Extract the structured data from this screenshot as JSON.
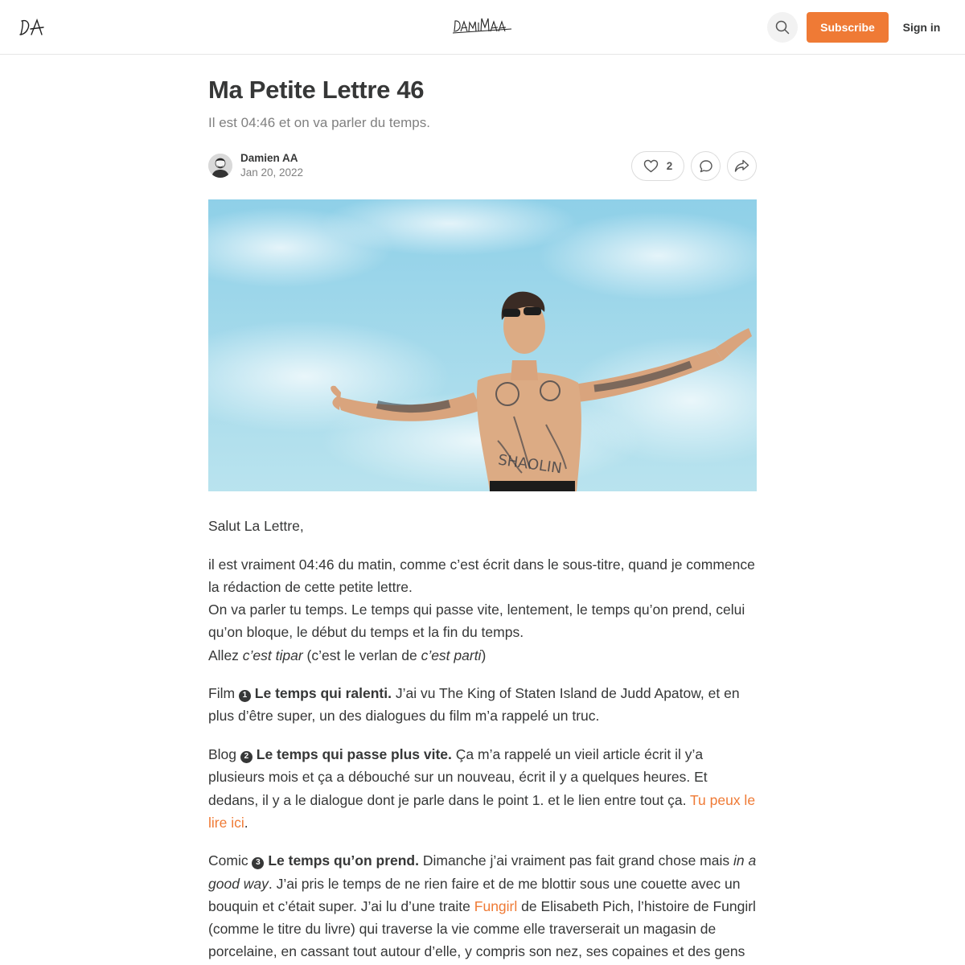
{
  "header": {
    "logo_left": "DA",
    "logo_center": "DAMIMAA",
    "subscribe_label": "Subscribe",
    "signin_label": "Sign in"
  },
  "post": {
    "title": "Ma Petite Lettre 46",
    "subtitle": "Il est 04:46 et on va parler du temps.",
    "author": "Damien AA",
    "date": "Jan 20, 2022",
    "like_count": "2"
  },
  "body": {
    "greeting": "Salut La Lettre,",
    "intro_1": "il est vraiment 04:46 du matin, comme c’est écrit dans le sous-titre, quand je commence la rédaction de cette petite lettre.",
    "intro_2": "On va parler tu temps. Le temps qui passe vite, lentement, le temps qu’on prend, celui qu’on bloque, le début du temps et la fin du temps.",
    "intro_3_a": "Allez ",
    "intro_3_em1": "c’est tipar",
    "intro_3_b": " (c’est le verlan de ",
    "intro_3_em2": "c’est parti",
    "intro_3_c": ")",
    "film_prefix": "Film ",
    "film_num": "1",
    "film_title": "Le temps qui ralenti.",
    "film_text": " J’ai vu The King of Staten Island de Judd Apatow, et en plus d’être super, un des dialogues du film m’a rappelé un truc.",
    "blog_prefix": "Blog ",
    "blog_num": "2",
    "blog_title": "Le temps qui passe plus vite.",
    "blog_text": " Ça m’a rappelé un vieil article écrit il y’a plusieurs mois et ça a débouché sur un nouveau, écrit il y a quelques heures. Et dedans, il y a le dialogue dont je parle dans le point 1. et le lien entre tout ça. ",
    "blog_link": "Tu peux le lire ici",
    "blog_end": ".",
    "comic_prefix": "Comic ",
    "comic_num": "3",
    "comic_title": "Le temps qu’on prend.",
    "comic_text_1": " Dimanche j’ai vraiment pas fait grand chose mais ",
    "comic_em": "in a good way",
    "comic_text_2": ". J’ai pris le temps de ne rien faire et de me blottir sous une couette avec un bouquin et c’était super. J’ai lu d’une traite ",
    "comic_link": "Fungirl",
    "comic_text_3": " de Elisabeth Pich, l’histoire de Fungirl (comme le titre du livre) qui traverse la vie comme elle traverserait un magasin de porcelaine, en cassant tout autour d’elle, y compris son nez, ses copaines et des gens morts (elle travaille dans un funérarium). Rien de mieux que Elisabeth Pich elle-même"
  },
  "colors": {
    "accent": "#ef7a35",
    "text": "#363737",
    "muted": "#808080",
    "sky": "#a9dcec"
  }
}
